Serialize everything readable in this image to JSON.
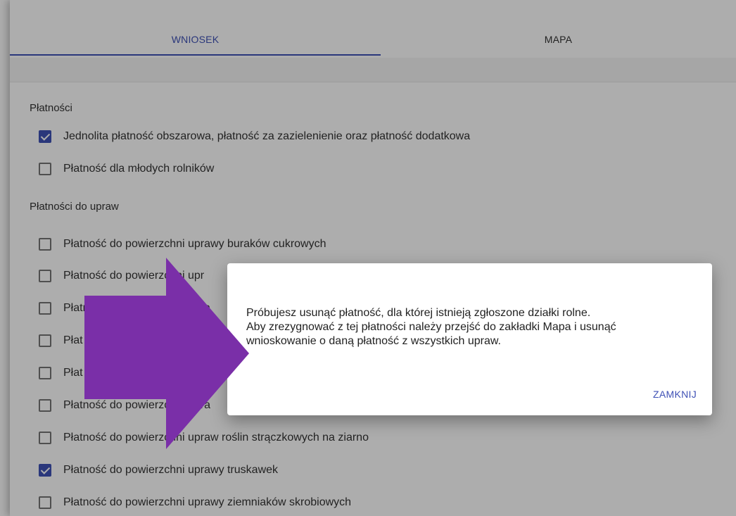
{
  "tabs": [
    {
      "label": "WNIOSEK",
      "active": true
    },
    {
      "label": "MAPA",
      "active": false
    }
  ],
  "sections": {
    "platnosci": {
      "title": "Płatności",
      "items": [
        {
          "label": "Jednolita płatność obszarowa, płatność za zazielenienie oraz płatność dodatkowa",
          "checked": true
        },
        {
          "label": "Płatność dla młodych rolników",
          "checked": false
        }
      ]
    },
    "uprawy": {
      "title": "Płatności do upraw",
      "items": [
        {
          "label": "Płatność do powierzchni uprawy buraków cukrowych",
          "checked": false
        },
        {
          "label": "Płatność do powierzchni upr",
          "checked": false
        },
        {
          "label": "Płatność do powierzchni upra",
          "checked": false
        },
        {
          "label": "Płat",
          "checked": false
        },
        {
          "label": "Płat",
          "checked": false
        },
        {
          "label": "Płatność do powierzchni upra",
          "checked": false
        },
        {
          "label": "Płatność do powierzchni upraw roślin strączkowych na ziarno",
          "checked": false
        },
        {
          "label": "Płatność do powierzchni uprawy truskawek",
          "checked": true
        },
        {
          "label": "Płatność do powierzchni uprawy ziemniaków skrobiowych",
          "checked": false
        }
      ]
    }
  },
  "dialog": {
    "lines": [
      "Próbujesz usunąć płatność, dla której istnieją zgłoszone działki rolne.",
      "Aby zrezygnować z tej płatności należy przejść do zakładki Mapa i usunąć",
      "wnioskowanie o daną płatność z wszystkich upraw."
    ],
    "close_label": "ZAMKNIJ"
  },
  "colors": {
    "accent": "#3f51b5",
    "arrow": "#7a2fa8"
  }
}
